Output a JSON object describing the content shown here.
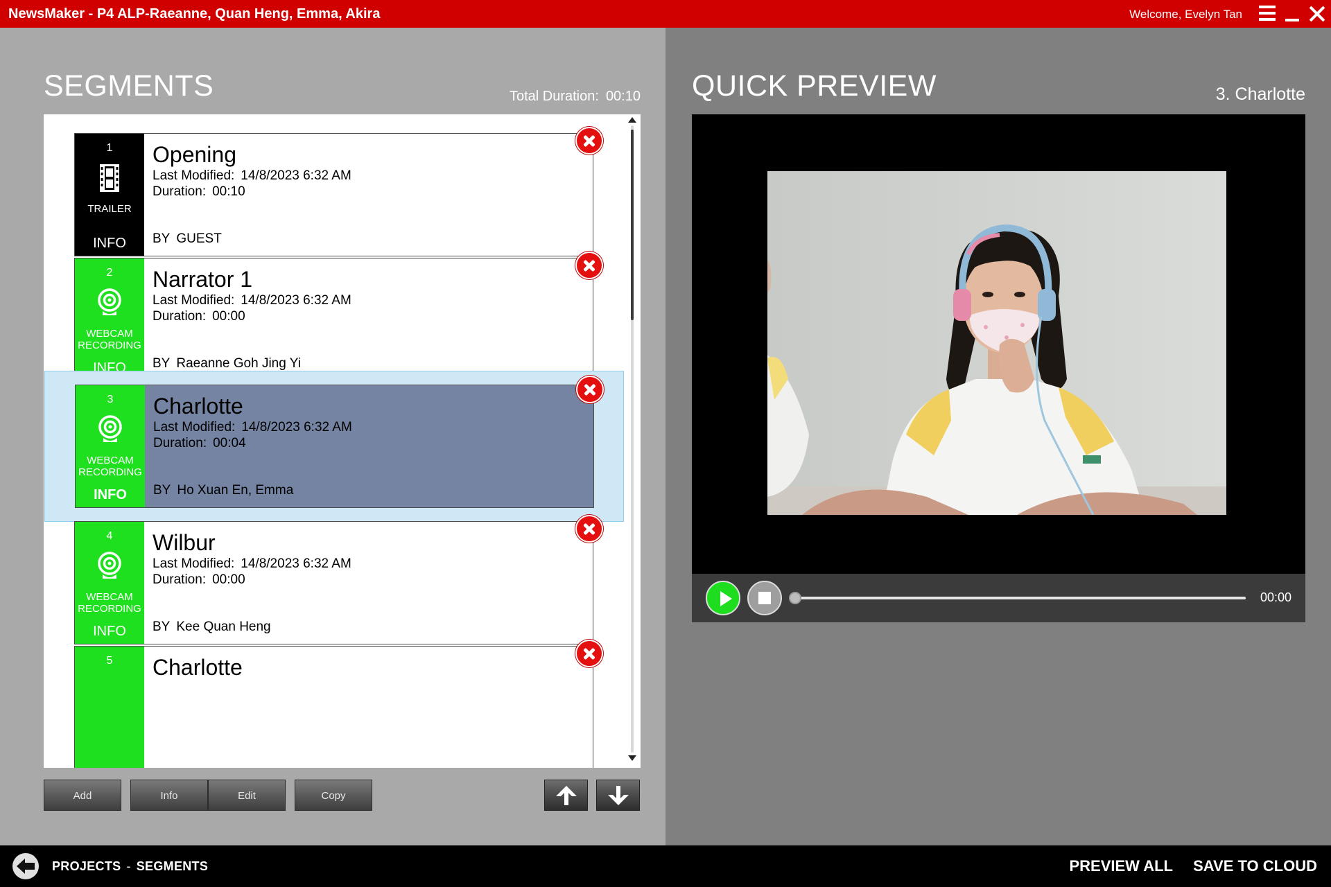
{
  "titlebar": {
    "app_title": "NewsMaker - P4 ALP-Raeanne, Quan Heng, Emma, Akira",
    "welcome": "Welcome, Evelyn Tan"
  },
  "segments_panel": {
    "heading": "SEGMENTS",
    "total_duration_label": "Total Duration:",
    "total_duration_value": "00:10",
    "labels": {
      "last_modified": "Last Modified:",
      "duration": "Duration:",
      "by": "BY",
      "info": "INFO"
    },
    "items": [
      {
        "number": "1",
        "type_line1": "TRAILER",
        "type_line2": "",
        "title": "Opening",
        "last_modified": "14/8/2023 6:32 AM",
        "duration": "00:10",
        "by": "GUEST",
        "icon": "film-icon",
        "color": "#000000"
      },
      {
        "number": "2",
        "type_line1": "WEBCAM",
        "type_line2": "RECORDING",
        "title": "Narrator 1",
        "last_modified": "14/8/2023 6:32 AM",
        "duration": "00:00",
        "by": "Raeanne Goh Jing Yi",
        "icon": "webcam-icon",
        "color": "#1ee01e"
      },
      {
        "number": "3",
        "type_line1": "WEBCAM",
        "type_line2": "RECORDING",
        "title": "Charlotte",
        "last_modified": "14/8/2023 6:32 AM",
        "duration": "00:04",
        "by": "Ho Xuan En, Emma",
        "icon": "webcam-icon",
        "color": "#1ee01e",
        "selected": true
      },
      {
        "number": "4",
        "type_line1": "WEBCAM",
        "type_line2": "RECORDING",
        "title": "Wilbur",
        "last_modified": "14/8/2023 6:32 AM",
        "duration": "00:00",
        "by": "Kee Quan Heng",
        "icon": "webcam-icon",
        "color": "#1ee01e"
      },
      {
        "number": "5",
        "type_line1": "",
        "type_line2": "",
        "title": "Charlotte",
        "last_modified": "",
        "duration": "",
        "by": "",
        "icon": "webcam-icon",
        "color": "#1ee01e"
      }
    ],
    "buttons": {
      "add": "Add",
      "info": "Info",
      "edit": "Edit",
      "copy": "Copy"
    }
  },
  "preview_panel": {
    "heading": "QUICK PREVIEW",
    "current_segment": "3. Charlotte",
    "time": "00:00",
    "progress": 0
  },
  "bottombar": {
    "breadcrumb_projects": "PROJECTS",
    "breadcrumb_separator": "-",
    "breadcrumb_segments": "SEGMENTS",
    "preview_all": "PREVIEW ALL",
    "save_to_cloud": "SAVE TO CLOUD"
  },
  "colors": {
    "titlebar": "#d10000",
    "webcam_tile": "#1ee01e",
    "trailer_tile": "#000000",
    "selected_card": "#7484a2",
    "selected_row": "#cfe8f6",
    "delete": "#e41010"
  }
}
